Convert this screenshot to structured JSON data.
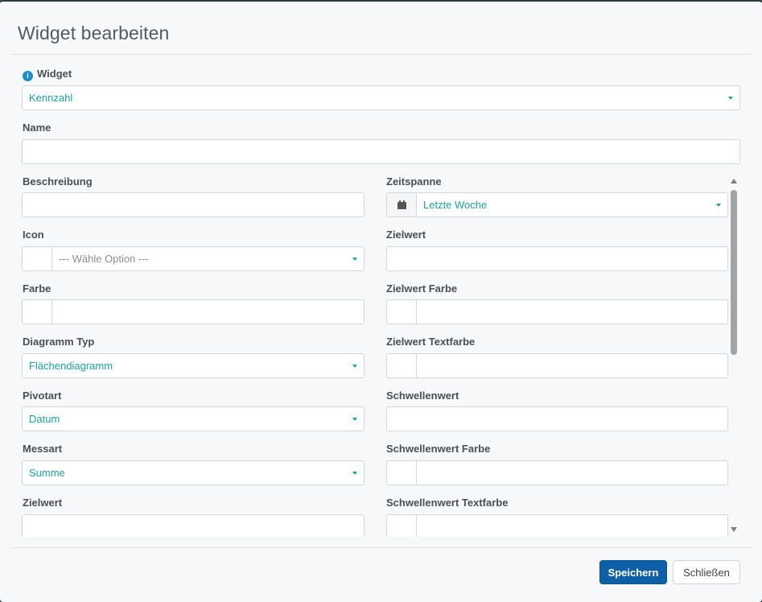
{
  "dialog": {
    "title": "Widget bearbeiten"
  },
  "form": {
    "widget": {
      "label": "Widget",
      "value": "Kennzahl",
      "info_icon": "info-icon"
    },
    "name": {
      "label": "Name",
      "value": ""
    },
    "beschreibung": {
      "label": "Beschreibung",
      "value": ""
    },
    "icon": {
      "label": "Icon",
      "placeholder": "--- Wähle Option ---"
    },
    "farbe": {
      "label": "Farbe",
      "value": ""
    },
    "diagramm_typ": {
      "label": "Diagramm Typ",
      "value": "Flächendiagramm"
    },
    "pivotart": {
      "label": "Pivotart",
      "value": "Datum"
    },
    "messart": {
      "label": "Messart",
      "value": "Summe"
    },
    "zielwert_left": {
      "label": "Zielwert",
      "value": ""
    },
    "zeitspanne": {
      "label": "Zeitspanne",
      "value": "Letzte Woche",
      "icon": "calendar-icon"
    },
    "zielwert": {
      "label": "Zielwert",
      "value": ""
    },
    "zielwert_farbe": {
      "label": "Zielwert Farbe",
      "value": ""
    },
    "zielwert_textfarbe": {
      "label": "Zielwert Textfarbe",
      "value": ""
    },
    "schwellenwert": {
      "label": "Schwellenwert",
      "value": ""
    },
    "schwellenwert_farbe": {
      "label": "Schwellenwert Farbe",
      "value": ""
    },
    "schwellenwert_textfarbe": {
      "label": "Schwellenwert Textfarbe",
      "value": ""
    }
  },
  "footer": {
    "save_label": "Speichern",
    "close_label": "Schließen"
  },
  "colors": {
    "accent_text": "#1aa69a",
    "primary_button": "#0f5fa8",
    "info_icon": "#1f8fc9"
  }
}
